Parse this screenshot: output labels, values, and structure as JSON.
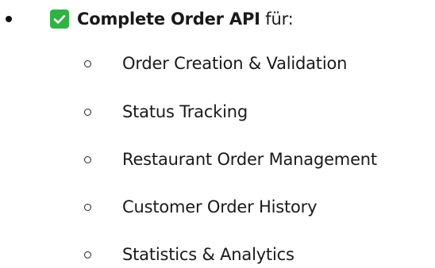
{
  "main_item": {
    "check_icon": "checkmark-box-icon",
    "check_color": "#2fb344",
    "bold_text": "Complete Order API",
    "rest_text": " für:"
  },
  "sub_items": [
    {
      "label": "Order Creation & Validation"
    },
    {
      "label": "Status Tracking"
    },
    {
      "label": "Restaurant Order Management"
    },
    {
      "label": "Customer Order History"
    },
    {
      "label": "Statistics & Analytics"
    }
  ]
}
